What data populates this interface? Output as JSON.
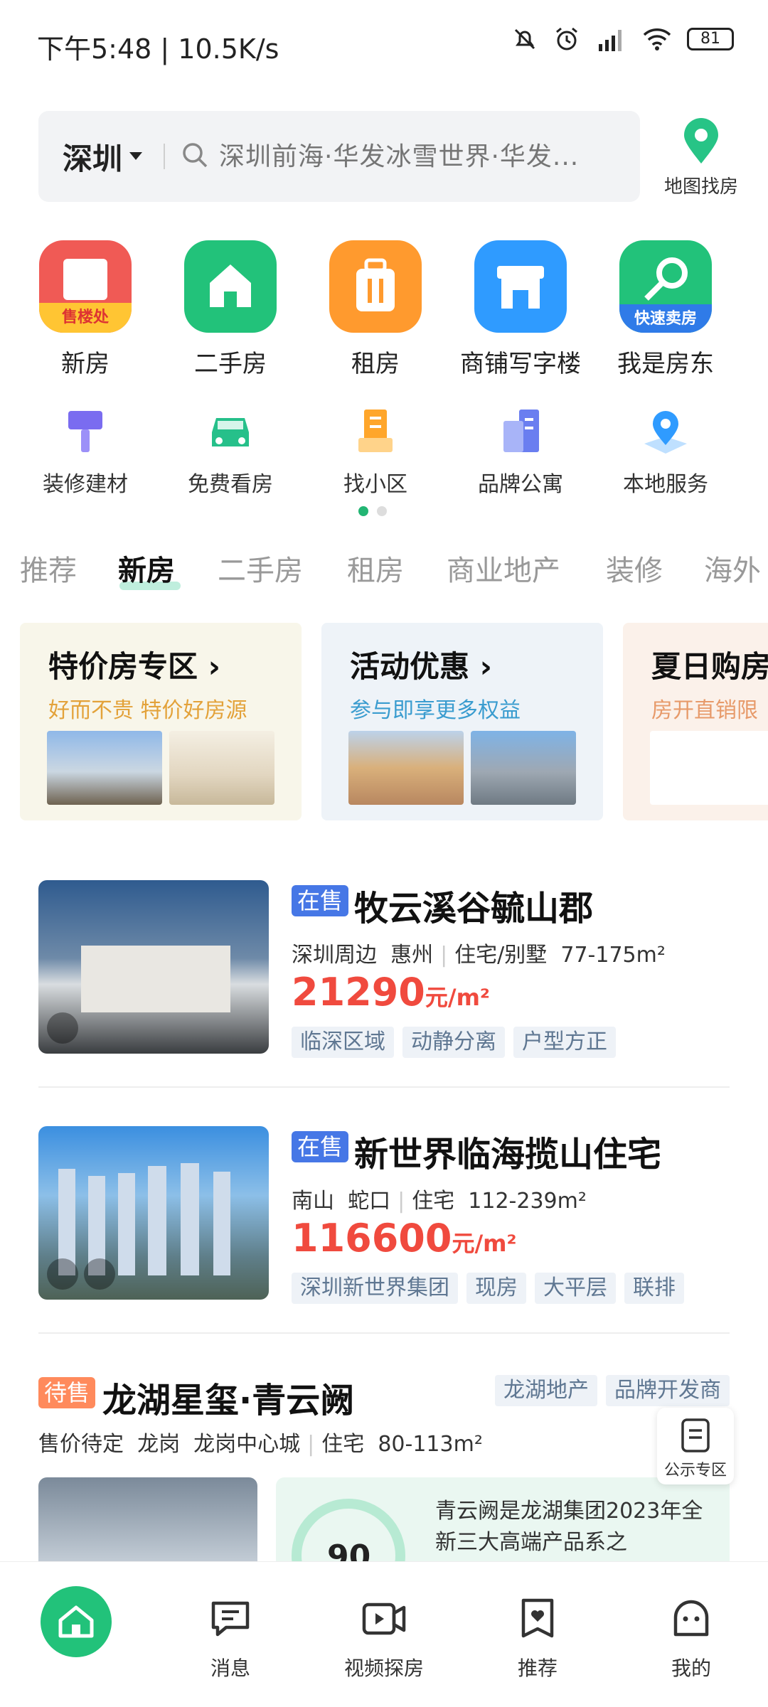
{
  "status_bar": {
    "time": "下午5:48 | 10.5K/s",
    "battery": "81"
  },
  "search": {
    "city": "深圳",
    "placeholder": "深圳前海·华发冰雪世界·华发..."
  },
  "map_button": {
    "label": "地图找房",
    "icon": "map-pin-icon"
  },
  "main_categories": [
    {
      "label": "新房",
      "icon": "new-house-icon",
      "badge": "售楼处",
      "color": "#f05a55"
    },
    {
      "label": "二手房",
      "icon": "second-hand-house-icon",
      "color": "#22c27a"
    },
    {
      "label": "租房",
      "icon": "rent-luggage-icon",
      "color": "#ff9a2e"
    },
    {
      "label": "商铺写字楼",
      "icon": "shop-icon",
      "color": "#2f9bff"
    },
    {
      "label": "我是房东",
      "icon": "key-icon",
      "badge": "快速卖房",
      "color": "#22c27a"
    }
  ],
  "sub_categories": [
    {
      "label": "装修建材",
      "icon": "paint-brush-icon"
    },
    {
      "label": "免费看房",
      "icon": "car-icon"
    },
    {
      "label": "找小区",
      "icon": "building-icon"
    },
    {
      "label": "品牌公寓",
      "icon": "apartment-icon"
    },
    {
      "label": "本地服务",
      "icon": "location-icon"
    }
  ],
  "tabs": [
    "推荐",
    "新房",
    "二手房",
    "租房",
    "商业地产",
    "装修",
    "海外"
  ],
  "active_tab": "新房",
  "promos": [
    {
      "title": "特价房专区",
      "subtitle": "好而不贵 特价好房源",
      "subtitle_color": "#e3a23a"
    },
    {
      "title": "活动优惠",
      "subtitle": "参与即享更多权益",
      "subtitle_color": "#3a9ccf"
    },
    {
      "title": "夏日购房",
      "subtitle": "房开直销限",
      "subtitle_color": "#e79a6a"
    }
  ],
  "listings": [
    {
      "status": "在售",
      "name": "牧云溪谷毓山郡",
      "meta": [
        "深圳周边",
        "惠州",
        "住宅/别墅",
        "77-175m²"
      ],
      "price": "21290",
      "unit": "元/m²",
      "tags": [
        "临深区域",
        "动静分离",
        "户型方正"
      ]
    },
    {
      "status": "在售",
      "name": "新世界临海揽山住宅",
      "meta": [
        "南山",
        "蛇口",
        "住宅",
        "112-239m²"
      ],
      "price": "116600",
      "unit": "元/m²",
      "tags": [
        "深圳新世界集团",
        "现房",
        "大平层",
        "联排"
      ]
    },
    {
      "status": "待售",
      "name": "龙湖星玺·青云阙",
      "tags": [
        "龙湖地产",
        "品牌开发商"
      ],
      "meta": [
        "售价待定",
        "龙岗",
        "龙岗中心城",
        "住宅",
        "80-113m²"
      ],
      "score": "90",
      "description": "青云阙是龙湖集团2023年全新三大高端产品系之"
    }
  ],
  "float_button": {
    "label": "公示专区"
  },
  "bottom_nav": [
    {
      "label": "",
      "icon": "home-icon"
    },
    {
      "label": "消息",
      "icon": "message-icon"
    },
    {
      "label": "视频探房",
      "icon": "video-icon"
    },
    {
      "label": "推荐",
      "icon": "recommend-icon"
    },
    {
      "label": "我的",
      "icon": "profile-icon"
    }
  ]
}
